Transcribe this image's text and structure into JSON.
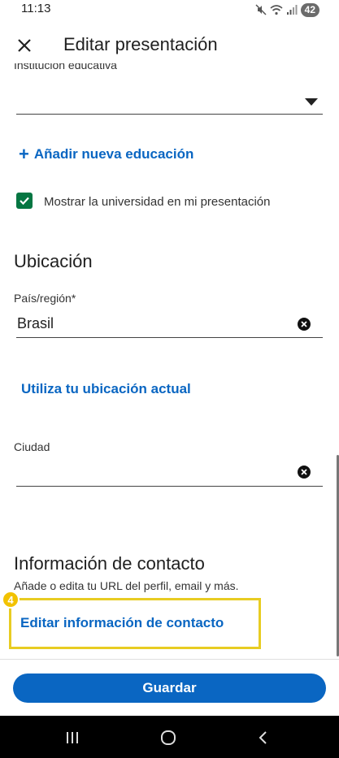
{
  "status_bar": {
    "time": "11:13",
    "battery": "42"
  },
  "app_bar": {
    "title": "Editar presentación",
    "close_icon": "close-icon"
  },
  "education": {
    "institution_label": "Institución educativa",
    "institution_value": "",
    "add_education_label": "Añadir nueva educación",
    "show_in_intro_label": "Mostrar la universidad en mi presentación",
    "show_in_intro_checked": true
  },
  "location": {
    "title": "Ubicación",
    "country_label": "País/región*",
    "country_value": "Brasil",
    "use_current_location_label": "Utiliza tu ubicación actual",
    "city_label": "Ciudad",
    "city_value": ""
  },
  "contact": {
    "title": "Información de contacto",
    "description": "Añade o edita tu URL del perfil, email y más.",
    "edit_link_label": "Editar información de contacto"
  },
  "annotation": {
    "badge_number": "4",
    "color": "#e8cc22"
  },
  "footer": {
    "save_label": "Guardar"
  },
  "colors": {
    "accent": "#0a66c2",
    "checkbox": "#057642",
    "highlight": "#e8cc22"
  },
  "nav_bar": {
    "icons": [
      "recent-apps-icon",
      "home-icon",
      "back-icon"
    ]
  }
}
